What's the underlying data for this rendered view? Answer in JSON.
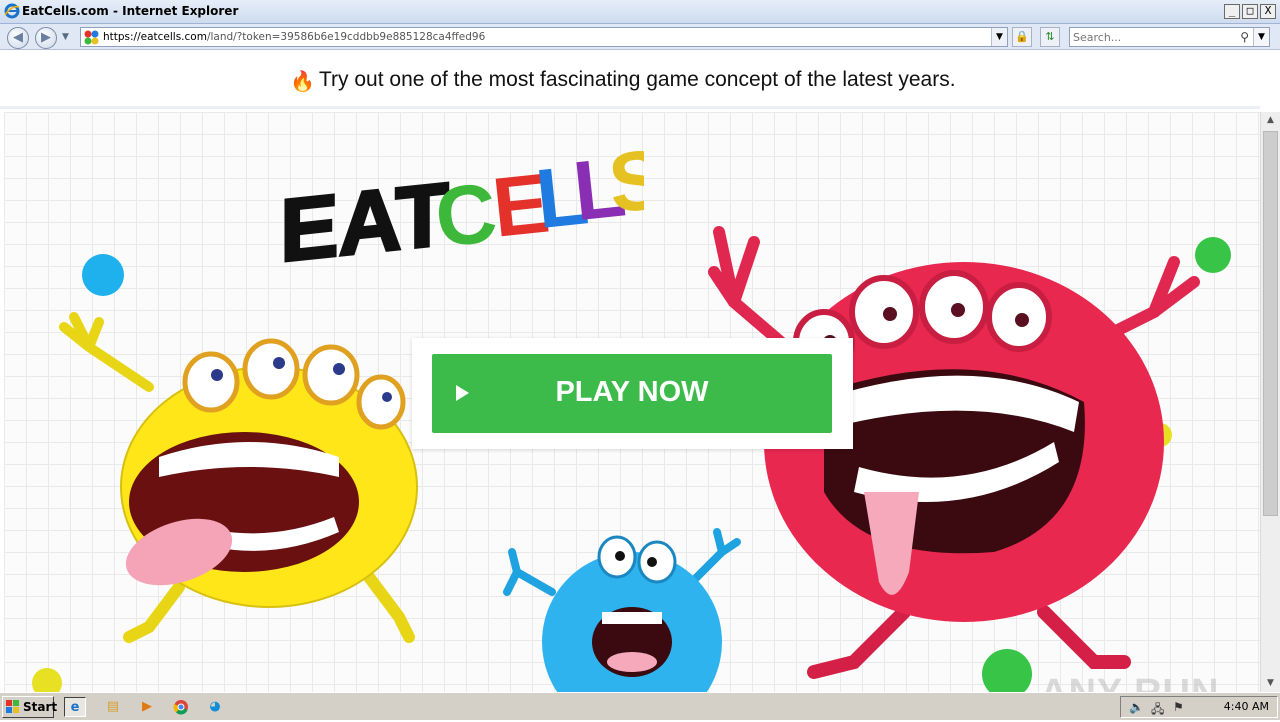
{
  "window": {
    "title": "EatCells.com - Internet Explorer",
    "controls": [
      "_",
      "□",
      "X"
    ]
  },
  "navbar": {
    "url_host": "https://eatcells.com",
    "url_rest": "/land/?token=39586b6e19cddbb9e885128ca4ffed96",
    "search_placeholder": "Search..."
  },
  "page": {
    "headline": "Try out one of the most fascinating game concept of the latest years.",
    "logo_word1": "EAT",
    "logo_word2_letters": [
      "C",
      "E",
      "L",
      "L",
      "S"
    ],
    "logo_word2_colors": [
      "#3db83a",
      "#e4322b",
      "#1f7be0",
      "#8a2fb4",
      "#e5c221"
    ],
    "play_button_label": "PLAY NOW",
    "button_color": "#3cba4a"
  },
  "watermark": "ANY RUN",
  "taskbar": {
    "start_label": "Start",
    "clock": "4:40 AM"
  }
}
